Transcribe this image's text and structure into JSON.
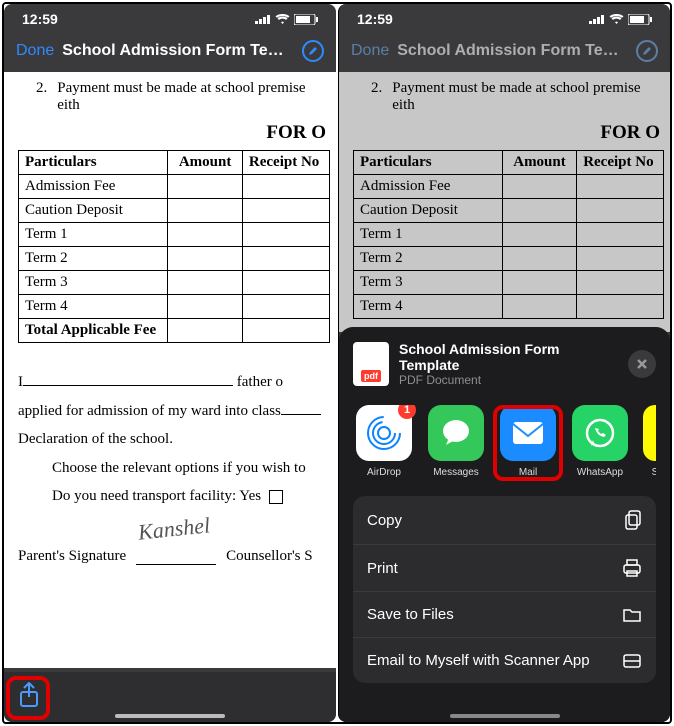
{
  "status": {
    "time": "12:59",
    "signal_label": "signal",
    "wifi_label": "wifi",
    "battery_label": "battery"
  },
  "header": {
    "done": "Done",
    "title": "School Admission Form Temp...",
    "markup": "Ⓐ"
  },
  "doc": {
    "bullet_num": "2.",
    "bullet_text": "Payment must be made at school premise eith",
    "heading": "FOR O",
    "columns": [
      "Particulars",
      "Amount",
      "Receipt No"
    ],
    "rows": [
      "Admission Fee",
      "Caution Deposit",
      "Term 1",
      "Term 2",
      "Term 3",
      "Term 4",
      "Total Applicable Fee"
    ],
    "para1_prefix": "I",
    "para1_suffix": " father o",
    "para2": "applied for admission of my ward into class",
    "para3": "Declaration of the school.",
    "para4": "Choose the relevant options if you wish to",
    "para5": "Do you need transport facility:  Yes",
    "sig_label": "Parent's Signature",
    "sig_label2": "Counsellor's S",
    "signature": "Kanshel"
  },
  "share": {
    "file_title": "School Admission Form Template",
    "file_sub": "PDF Document",
    "pdf_badge": "pdf",
    "apps": [
      {
        "name": "AirDrop",
        "badge": "1"
      },
      {
        "name": "Messages"
      },
      {
        "name": "Mail"
      },
      {
        "name": "WhatsApp"
      },
      {
        "name": "S"
      }
    ],
    "actions": [
      "Copy",
      "Print",
      "Save to Files",
      "Email to Myself with Scanner App"
    ]
  },
  "chart_data": {
    "type": "table",
    "title": "FOR O",
    "columns": [
      "Particulars",
      "Amount",
      "Receipt No"
    ],
    "rows": [
      {
        "Particulars": "Admission Fee",
        "Amount": "",
        "Receipt No": ""
      },
      {
        "Particulars": "Caution Deposit",
        "Amount": "",
        "Receipt No": ""
      },
      {
        "Particulars": "Term 1",
        "Amount": "",
        "Receipt No": ""
      },
      {
        "Particulars": "Term 2",
        "Amount": "",
        "Receipt No": ""
      },
      {
        "Particulars": "Term 3",
        "Amount": "",
        "Receipt No": ""
      },
      {
        "Particulars": "Term 4",
        "Amount": "",
        "Receipt No": ""
      },
      {
        "Particulars": "Total Applicable Fee",
        "Amount": "",
        "Receipt No": ""
      }
    ]
  }
}
